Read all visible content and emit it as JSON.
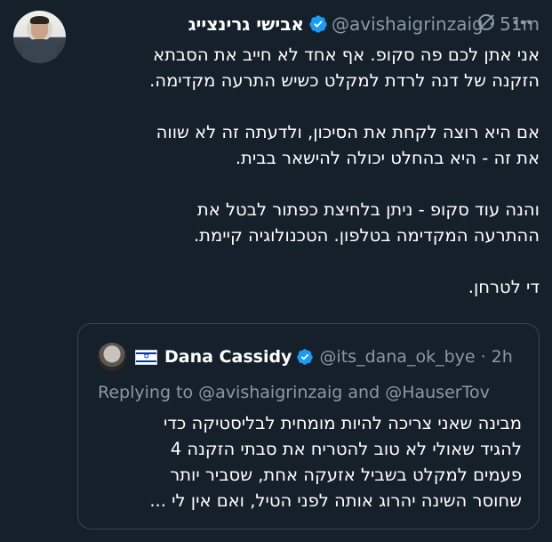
{
  "tweet": {
    "display_name": "אבישי גרינצייג",
    "handle": "@avishaigrinzaig",
    "separator": "·",
    "time": "51m",
    "icons": {
      "mute": "slashed-circle-icon",
      "more": "more-dots-icon",
      "verified": "verified-badge-icon"
    },
    "paragraphs": [
      {
        "lines": [
          "אני אתן לכם פה סקופ. אף אחד לא חייב את הסבתא",
          "הזקנה של דנה לרדת למקלט כשיש התרעה מקדימה."
        ]
      },
      {
        "lines": [
          "אם היא רוצה לקחת את הסיכון, ולדעתה זה לא שווה",
          "את זה - היא בהחלט יכולה להישאר בבית."
        ]
      },
      {
        "lines": [
          "והנה עוד סקופ - ניתן בלחיצת כפתור לבטל את",
          "ההתרעה המקדימה בטלפון.  הטכנולוגיה קיימת."
        ]
      },
      {
        "lines": [
          "די לטרחן."
        ]
      }
    ]
  },
  "quote": {
    "display_name": "Dana Cassidy",
    "handle": "@its_dana_ok_bye",
    "separator": "·",
    "time": "2h",
    "flag_icon": "israel-flag-icon",
    "replying_prefix": "Replying to",
    "mention_1": "@avishaigrinzaig",
    "and_word": "and",
    "mention_2": "@HauserTov",
    "lines": [
      "מבינה שאני צריכה להיות מומחית לבליסטיקה כדי",
      "להגיד שאולי לא טוב להטריח את סבתי הזקנה 4",
      "פעמים למקלט בשביל אזעקה אחת, שסביר יותר",
      "שחוסר השינה יהרוג אותה לפני הטיל, ואם אין לי ..."
    ]
  },
  "colors": {
    "background": "#15202b",
    "text": "#ffffff",
    "secondary": "#8b98a5",
    "verified": "#1d9bf0",
    "border": "#38444d"
  }
}
